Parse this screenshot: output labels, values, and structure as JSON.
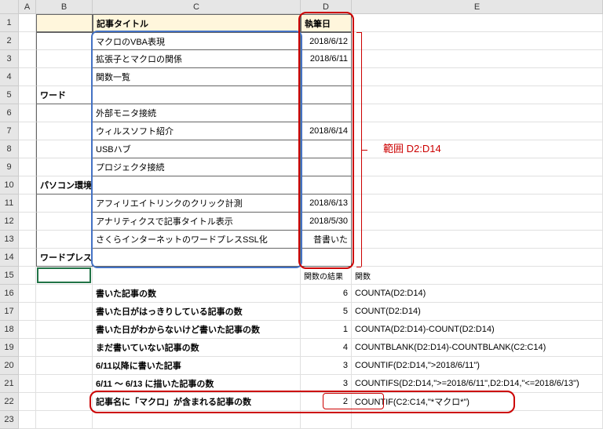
{
  "columns": [
    "A",
    "B",
    "C",
    "D",
    "E"
  ],
  "table": {
    "headers": {
      "B": "",
      "C": "記事タイトル",
      "D": "執筆日"
    },
    "rows": [
      {
        "r": 2,
        "B": "",
        "C": "マクロのVBA表現",
        "D": "2018/6/12"
      },
      {
        "r": 3,
        "B": "",
        "C": "拡張子とマクロの関係",
        "D": "2018/6/11"
      },
      {
        "r": 4,
        "B": "",
        "C": "関数一覧",
        "D": ""
      },
      {
        "r": 5,
        "B": "ワード",
        "C": "",
        "D": ""
      },
      {
        "r": 6,
        "B": "",
        "C": "外部モニタ接続",
        "D": ""
      },
      {
        "r": 7,
        "B": "",
        "C": "ウィルスソフト紹介",
        "D": "2018/6/14"
      },
      {
        "r": 8,
        "B": "",
        "C": "USBハブ",
        "D": ""
      },
      {
        "r": 9,
        "B": "",
        "C": "プロジェクタ接続",
        "D": ""
      },
      {
        "r": 10,
        "B": "パソコン環境",
        "C": "",
        "D": ""
      },
      {
        "r": 11,
        "B": "",
        "C": "アフィリエイトリンクのクリック計測",
        "D": "2018/6/13"
      },
      {
        "r": 12,
        "B": "",
        "C": "アナリティクスで記事タイトル表示",
        "D": "2018/5/30"
      },
      {
        "r": 13,
        "B": "",
        "C": "さくらインターネットのワードプレスSSL化",
        "D": "昔書いた"
      },
      {
        "r": 14,
        "B": "ワードプレス",
        "C": "",
        "D": ""
      }
    ]
  },
  "labels": {
    "result_label": "関数の結果",
    "formula_label": "関数",
    "range_label": "範囲 D2:D14"
  },
  "summary": [
    {
      "r": 16,
      "C": "書いた記事の数",
      "D": "6",
      "E": "COUNTA(D2:D14)"
    },
    {
      "r": 17,
      "C": "書いた日がはっきりしている記事の数",
      "D": "5",
      "E": "COUNT(D2:D14)"
    },
    {
      "r": 18,
      "C": "書いた日がわからないけど書いた記事の数",
      "D": "1",
      "E": "COUNTA(D2:D14)-COUNT(D2:D14)"
    },
    {
      "r": 19,
      "C": "まだ書いていない記事の数",
      "D": "4",
      "E": "COUNTBLANK(D2:D14)-COUNTBLANK(C2:C14)"
    },
    {
      "r": 20,
      "C": "6/11以降に書いた記事",
      "D": "3",
      "E": "COUNTIF(D2:D14,\">2018/6/11\")"
    },
    {
      "r": 21,
      "C": "6/11 ～ 6/13 に描いた記事の数",
      "D": "3",
      "E": "COUNTIFS(D2:D14,\">=2018/6/11\",D2:D14,\"<=2018/6/13\")"
    },
    {
      "r": 22,
      "C": "記事名に「マクロ」が含まれる記事の数",
      "D": "2",
      "E": "COUNTIF(C2:C14,\"*マクロ*\")"
    }
  ],
  "row_count": 23,
  "chart_data": {
    "type": "table",
    "note": "Excel worksheet screenshot; summary formulas and results captured above."
  }
}
